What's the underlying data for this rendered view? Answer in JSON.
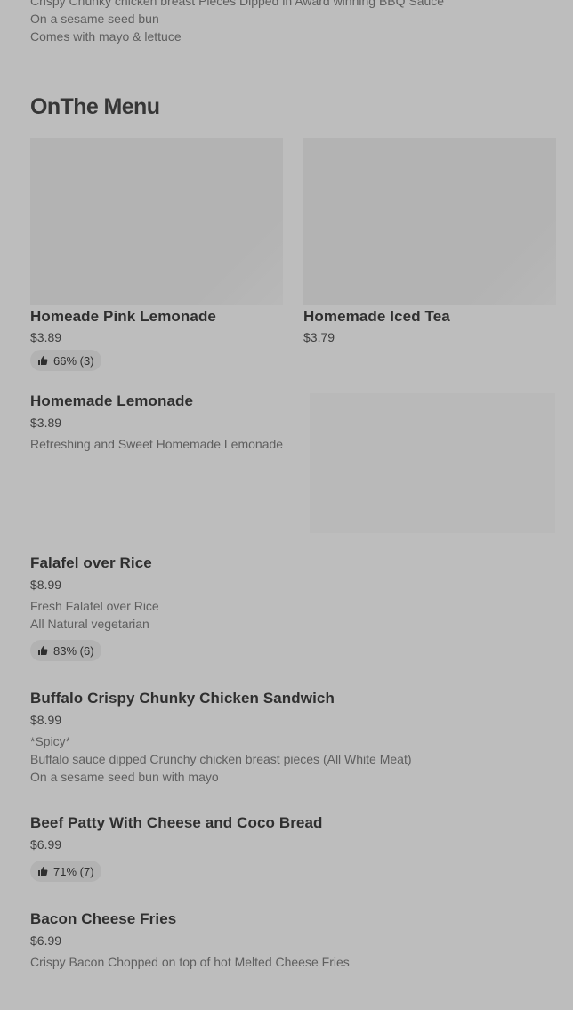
{
  "top_item": {
    "desc_lines": [
      "Crispy Chunky chicken breast Pieces Dipped in Award winning BBQ Sauce",
      "On a sesame seed bun",
      "Comes with mayo & lettuce"
    ]
  },
  "section": {
    "title": "OnThe Menu"
  },
  "featured": [
    {
      "title": "Homeade Pink Lemonade",
      "price": "$3.89",
      "rating": "66% (3)"
    },
    {
      "title": "Homemade Iced Tea",
      "price": "$3.79"
    }
  ],
  "items": [
    {
      "title": "Homemade Lemonade",
      "price": "$3.89",
      "desc_lines": [
        "Refreshing and Sweet Homemade Lemonade"
      ]
    },
    {
      "title": "Falafel over Rice",
      "price": "$8.99",
      "desc_lines": [
        "Fresh Falafel over Rice",
        "All Natural vegetarian"
      ],
      "rating": "83% (6)"
    },
    {
      "title": "Buffalo Crispy Chunky Chicken Sandwich",
      "price": "$8.99",
      "desc_lines": [
        "*Spicy*",
        "Buffalo sauce dipped Crunchy chicken breast pieces (All White Meat)",
        "On a sesame seed bun with mayo"
      ]
    },
    {
      "title": "Beef Patty With Cheese and Coco Bread",
      "price": "$6.99",
      "rating": "71% (7)"
    },
    {
      "title": "Bacon Cheese Fries",
      "price": "$6.99",
      "desc_lines": [
        "Crispy Bacon Chopped on top of hot Melted Cheese Fries"
      ]
    }
  ],
  "icons": {
    "rating": "thumbs-up-icon"
  }
}
